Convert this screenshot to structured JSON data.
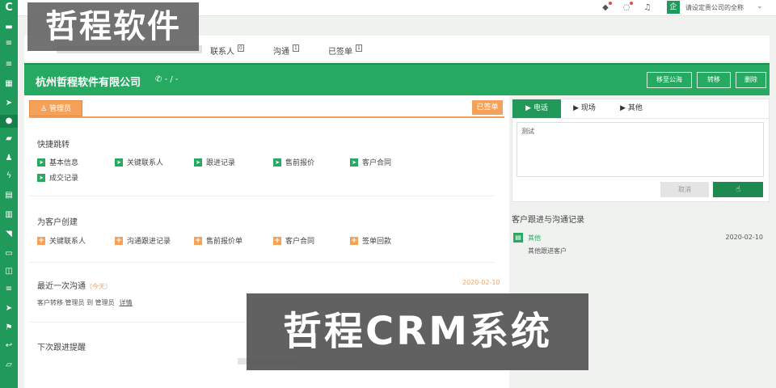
{
  "watermark": {
    "top": "哲程软件",
    "bottom": "哲程CRM系统"
  },
  "topbar": {
    "company_avatar": "企",
    "company_name": "请设定贵公司的全称",
    "icons": [
      "user-icon",
      "chat-icon",
      "bell-icon"
    ]
  },
  "sidebar": {
    "logo": "C",
    "icons": [
      "home-icon",
      "list-icon",
      "list-icon",
      "grid-icon",
      "send-icon",
      "leaf-icon",
      "folder-icon",
      "users-icon",
      "bolt-icon",
      "table-icon",
      "book-icon",
      "rss-icon",
      "monitor-icon",
      "database-icon",
      "menu-icon",
      "send-icon",
      "flag-icon",
      "back-icon",
      "folder-open-icon"
    ]
  },
  "tabs": [
    {
      "label": "联系人",
      "count": "0"
    },
    {
      "label": "沟通",
      "count": "1"
    },
    {
      "label": "已签单",
      "count": "1"
    }
  ],
  "header": {
    "company_title": "杭州哲程软件有限公司",
    "phone": "- / -",
    "buttons": {
      "to_pool": "移至公海",
      "transfer": "转移",
      "delete": "删除"
    }
  },
  "left": {
    "admin_tag": "管理员",
    "signed_tag": "已签单",
    "quick_jump": {
      "title": "快捷跳转",
      "items": [
        "基本信息",
        "关键联系人",
        "跟进记录",
        "售前报价",
        "客户合同",
        "成交记录"
      ]
    },
    "create": {
      "title": "为客户创建",
      "items": [
        "关键联系人",
        "沟通跟进记录",
        "售前报价单",
        "客户合同",
        "签单回款"
      ]
    },
    "last_comm": {
      "title": "最近一次沟通",
      "today": "（今天）",
      "date": "2020-02-10",
      "text": "客户转移 管理员 到 管理员",
      "detail": "详情"
    },
    "next_remind": {
      "title": "下次跟进提醒"
    }
  },
  "right": {
    "tabs": {
      "phone": "电话",
      "onsite": "现场",
      "other": "其他"
    },
    "textarea_value": "测试",
    "cancel": "取消",
    "followup": {
      "title": "客户跟进与沟通记录",
      "type": "其他",
      "date": "2020-02-10",
      "desc": "其他跟进客户"
    }
  }
}
